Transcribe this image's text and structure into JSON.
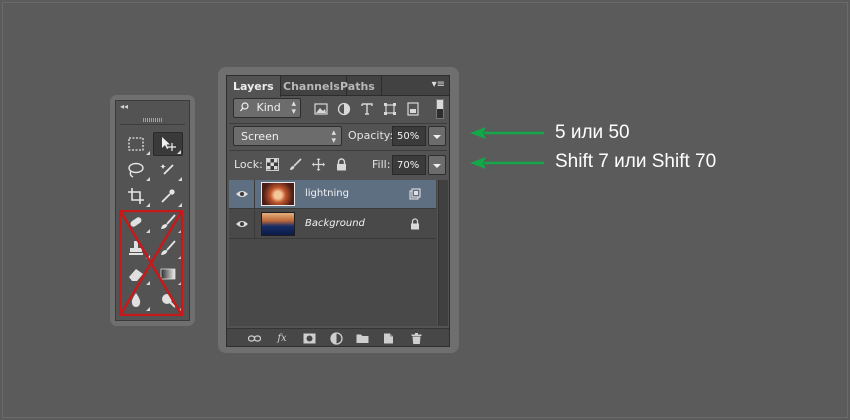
{
  "colors": {
    "annotation_arrow": "#15a84a",
    "cross_out": "#c8181a",
    "selected_layer": "#5f6f82"
  },
  "tools_panel": {
    "collapse_glyph": "◂◂",
    "tools": [
      {
        "name": "rectangular-marquee-icon"
      },
      {
        "name": "move-tool-icon",
        "active": true
      },
      {
        "name": "lasso-icon"
      },
      {
        "name": "magic-wand-icon"
      },
      {
        "name": "crop-icon"
      },
      {
        "name": "eyedropper-icon"
      },
      {
        "name": "spot-healing-icon"
      },
      {
        "name": "brush-icon"
      },
      {
        "name": "clone-stamp-icon"
      },
      {
        "name": "history-brush-icon"
      },
      {
        "name": "eraser-icon"
      },
      {
        "name": "gradient-icon"
      },
      {
        "name": "blur-icon"
      },
      {
        "name": "dodge-icon"
      }
    ]
  },
  "layers_panel": {
    "tabs": [
      {
        "label": "Layers",
        "active": true
      },
      {
        "label": "Channels",
        "active": false
      },
      {
        "label": "Paths",
        "active": false
      }
    ],
    "menu_glyph": "▾≡",
    "filter": {
      "kind_label": "Kind",
      "icons": [
        "pixel-filter-icon",
        "adjustment-filter-icon",
        "type-filter-icon",
        "shape-filter-icon",
        "smart-object-filter-icon"
      ]
    },
    "blend_mode": "Screen",
    "opacity_label": "Opacity:",
    "opacity_value": "50%",
    "lock_label": "Lock:",
    "fill_label": "Fill:",
    "fill_value": "70%",
    "layers": [
      {
        "name": "lightning",
        "selected": true,
        "italic": false,
        "badge": "smart-object-icon"
      },
      {
        "name": "Background",
        "selected": false,
        "italic": true,
        "badge": "lock-icon"
      }
    ],
    "footer_icons": [
      "link-layers-icon",
      "fx-icon",
      "add-mask-icon",
      "adjustment-layer-icon",
      "group-folder-icon",
      "new-layer-icon",
      "trash-icon"
    ],
    "fx_label": "fx"
  },
  "annotations": [
    {
      "text": "5 или 50"
    },
    {
      "text": "Shift 7 или Shift 70"
    }
  ]
}
